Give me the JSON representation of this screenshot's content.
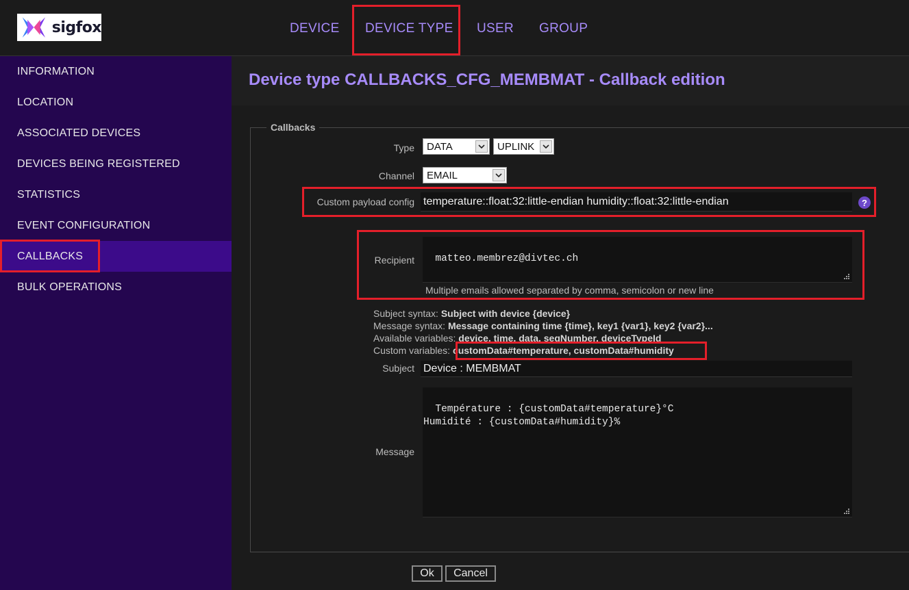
{
  "brand": {
    "name": "sigfox"
  },
  "topnav": [
    {
      "label": "DEVICE"
    },
    {
      "label": "DEVICE TYPE"
    },
    {
      "label": "USER"
    },
    {
      "label": "GROUP"
    }
  ],
  "sidebar": {
    "items": [
      {
        "label": "INFORMATION"
      },
      {
        "label": "LOCATION"
      },
      {
        "label": "ASSOCIATED DEVICES"
      },
      {
        "label": "DEVICES BEING REGISTERED"
      },
      {
        "label": "STATISTICS"
      },
      {
        "label": "EVENT CONFIGURATION"
      },
      {
        "label": "CALLBACKS"
      },
      {
        "label": "BULK OPERATIONS"
      }
    ],
    "active_index": 6
  },
  "page": {
    "title": "Device type CALLBACKS_CFG_MEMBMAT - Callback edition"
  },
  "form": {
    "legend": "Callbacks",
    "type_label": "Type",
    "type_value": "DATA",
    "direction_value": "UPLINK",
    "channel_label": "Channel",
    "channel_value": "EMAIL",
    "payload_label": "Custom payload config",
    "payload_value": "temperature::float:32:little-endian humidity::float:32:little-endian",
    "help_icon_text": "?",
    "recipient_label": "Recipient",
    "recipient_value": "matteo.membrez@divtec.ch",
    "recipient_hint": "Multiple emails allowed separated by comma, semicolon or new line",
    "subject_syntax_label": "Subject syntax:",
    "subject_syntax_value": "Subject with device {device}",
    "message_syntax_label": "Message syntax:",
    "message_syntax_value": "Message containing time {time}, key1 {var1}, key2 {var2}...",
    "available_vars_label": "Available variables:",
    "available_vars_value": "device, time, data, seqNumber, deviceTypeId",
    "custom_vars_label": "Custom variables:",
    "custom_vars_value": "customData#temperature, customData#humidity",
    "subject_label": "Subject",
    "subject_value": "Device : MEMBMAT",
    "message_label": "Message",
    "message_value": "Température : {customData#temperature}°C\nHumidité : {customData#humidity}%"
  },
  "buttons": {
    "ok": "Ok",
    "cancel": "Cancel"
  },
  "colors": {
    "accent": "#a78bfa",
    "sidebar_bg": "#24064f",
    "sidebar_active": "#3c0b8a",
    "highlight": "#e41f2a"
  }
}
